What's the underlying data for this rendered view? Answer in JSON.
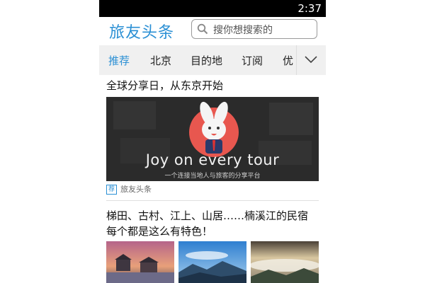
{
  "status_bar": {
    "time": "2:37"
  },
  "app_bar": {
    "logo": "旅友头条",
    "search_placeholder": "搜你想搜索的"
  },
  "tabs": [
    {
      "label": "推荐",
      "active": true
    },
    {
      "label": "北京",
      "active": false
    },
    {
      "label": "目的地",
      "active": false
    },
    {
      "label": "订阅",
      "active": false
    },
    {
      "label": "优",
      "active": false
    }
  ],
  "articles": [
    {
      "title": "全球分享日，从东京开始",
      "image": {
        "tagline": "Joy on every tour",
        "subtitle": "一个连接当地人与旅客的分享平台"
      },
      "badge": "荐",
      "source": "旅友头条"
    },
    {
      "title_line1": "梯田、古村、江上、山居……楠溪江的民宿",
      "title_line2": "每个都是这么有特色！"
    }
  ],
  "colors": {
    "accent": "#2a8fd4",
    "status_bar": "#000000",
    "tab_bar": "#f0f0f0"
  }
}
